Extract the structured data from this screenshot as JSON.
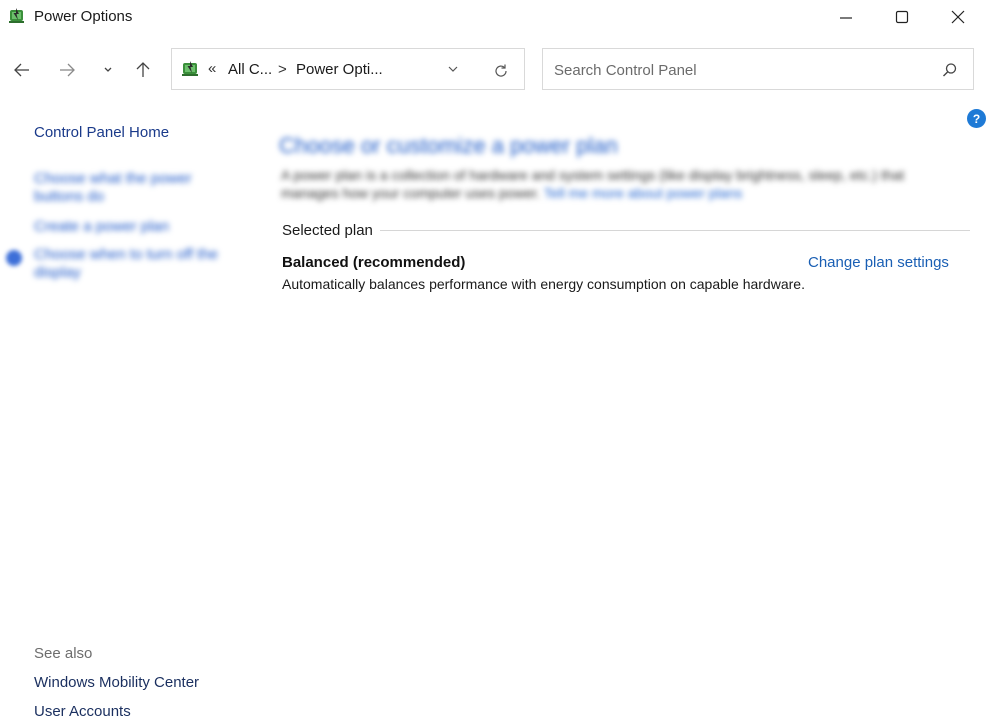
{
  "window": {
    "title": "Power Options"
  },
  "nav": {
    "address": {
      "chevron": "«",
      "item1": "All C...",
      "separator": ">",
      "item2": "Power Opti..."
    },
    "search": {
      "placeholder": "Search Control Panel"
    }
  },
  "sidebar": {
    "home_link": "Control Panel Home",
    "blurred_links": [
      "Choose what the power buttons do",
      "Create a power plan",
      "Choose when to turn off the display"
    ],
    "see_also": {
      "header": "See also",
      "links": [
        "Windows Mobility Center",
        "User Accounts"
      ]
    }
  },
  "main": {
    "heading": "Choose or customize a power plan",
    "description": "A power plan is a collection of hardware and system settings (like display brightness, sleep, etc.) that manages how your computer uses power.",
    "description_link": "Tell me more about power plans",
    "selected_plan_label": "Selected plan",
    "plan": {
      "name": "Balanced (recommended)",
      "change_link": "Change plan settings",
      "description": "Automatically balances performance with energy consumption on capable hardware."
    }
  },
  "help": {
    "label": "?"
  },
  "colors": {
    "link_blue": "#1a5fb4",
    "heading_blue": "#1e5bc8",
    "help_blue": "#1e7ad6",
    "border": "#d9d9d9"
  }
}
